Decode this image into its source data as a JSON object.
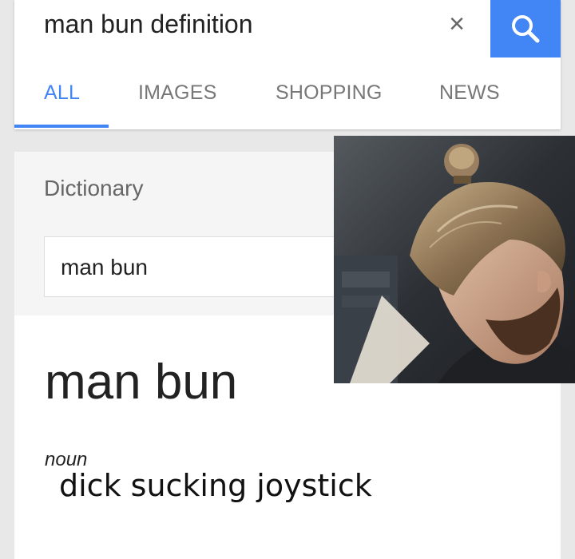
{
  "search": {
    "query": "man bun definition",
    "clear_icon": "×",
    "search_icon": "search-icon"
  },
  "tabs": [
    {
      "label": "ALL",
      "active": true
    },
    {
      "label": "IMAGES",
      "active": false
    },
    {
      "label": "SHOPPING",
      "active": false
    },
    {
      "label": "NEWS",
      "active": false
    }
  ],
  "dictionary": {
    "label": "Dictionary",
    "input_value": "man bun",
    "word": "man bun",
    "part_of_speech": "noun",
    "definition": "dick sucking joystick"
  },
  "colors": {
    "accent": "#4285f4",
    "background": "#e8e8e8",
    "card": "#ffffff"
  }
}
